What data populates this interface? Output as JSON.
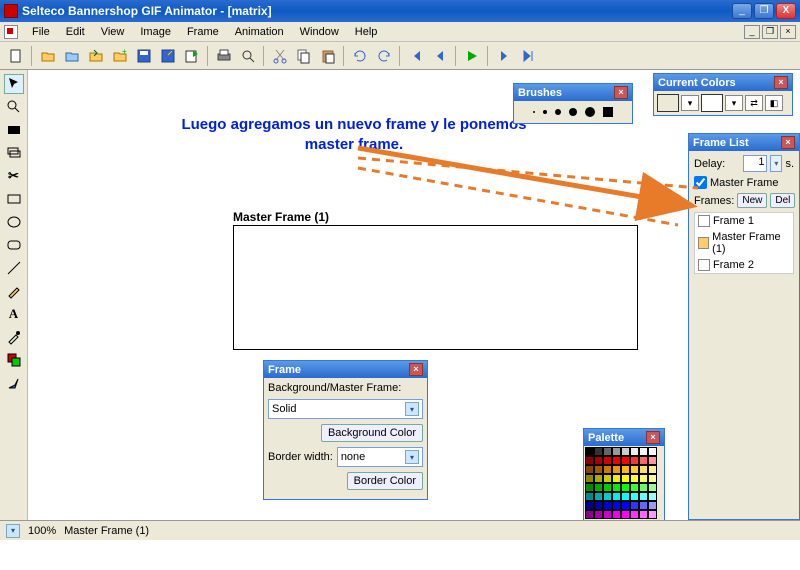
{
  "window": {
    "title": "Selteco Bannershop GIF Animator - [matrix]",
    "min": "_",
    "max": "❐",
    "close": "X"
  },
  "mdi": {
    "min": "_",
    "restore": "❐",
    "close": "×"
  },
  "menu": [
    "File",
    "Edit",
    "View",
    "Image",
    "Frame",
    "Animation",
    "Window",
    "Help"
  ],
  "annotation": {
    "line1": "Luego agregamos un nuevo frame y le ponemos",
    "line2": "master frame."
  },
  "master_frame_label": "Master Frame (1)",
  "panels": {
    "brushes": {
      "title": "Brushes"
    },
    "current_colors": {
      "title": "Current Colors",
      "fg": "#000000",
      "bg": "#ffffff"
    },
    "frame_list": {
      "title": "Frame List",
      "delay_label": "Delay:",
      "delay_value": "1",
      "delay_suffix": "s.",
      "master_checkbox": "Master Frame",
      "master_checked": true,
      "frames_label": "Frames:",
      "new_btn": "New",
      "del_btn": "Del",
      "items": [
        {
          "label": "Frame 1"
        },
        {
          "label": "Master Frame (1)"
        },
        {
          "label": "Frame 2"
        }
      ]
    },
    "frame": {
      "title": "Frame",
      "bg_label": "Background/Master Frame:",
      "bg_value": "Solid",
      "bg_color_btn": "Background Color",
      "border_width_label": "Border width:",
      "border_width_value": "none",
      "border_color_btn": "Border Color"
    },
    "palette": {
      "title": "Palette",
      "colors": [
        "#000",
        "#333",
        "#666",
        "#999",
        "#ccc",
        "#eee",
        "#f5f5f5",
        "#fff",
        "#800",
        "#a00",
        "#c00",
        "#e00",
        "#f00",
        "#f33",
        "#f66",
        "#f99",
        "#840",
        "#a50",
        "#c70",
        "#e90",
        "#fb0",
        "#fc3",
        "#fd6",
        "#fe9",
        "#880",
        "#aa0",
        "#cc0",
        "#ee0",
        "#ff0",
        "#ff3",
        "#ff6",
        "#ff9",
        "#080",
        "#0a0",
        "#0c0",
        "#0e0",
        "#0f0",
        "#3f3",
        "#6f6",
        "#9f9",
        "#088",
        "#0aa",
        "#0cc",
        "#0ee",
        "#0ff",
        "#3ff",
        "#6ff",
        "#9ff",
        "#008",
        "#00a",
        "#00c",
        "#00e",
        "#00f",
        "#33f",
        "#66f",
        "#99f",
        "#808",
        "#a0a",
        "#c0c",
        "#e0e",
        "#f0f",
        "#f3f",
        "#f6f",
        "#f9f"
      ]
    }
  },
  "statusbar": {
    "zoom": "100%",
    "frame": "Master Frame (1)"
  }
}
